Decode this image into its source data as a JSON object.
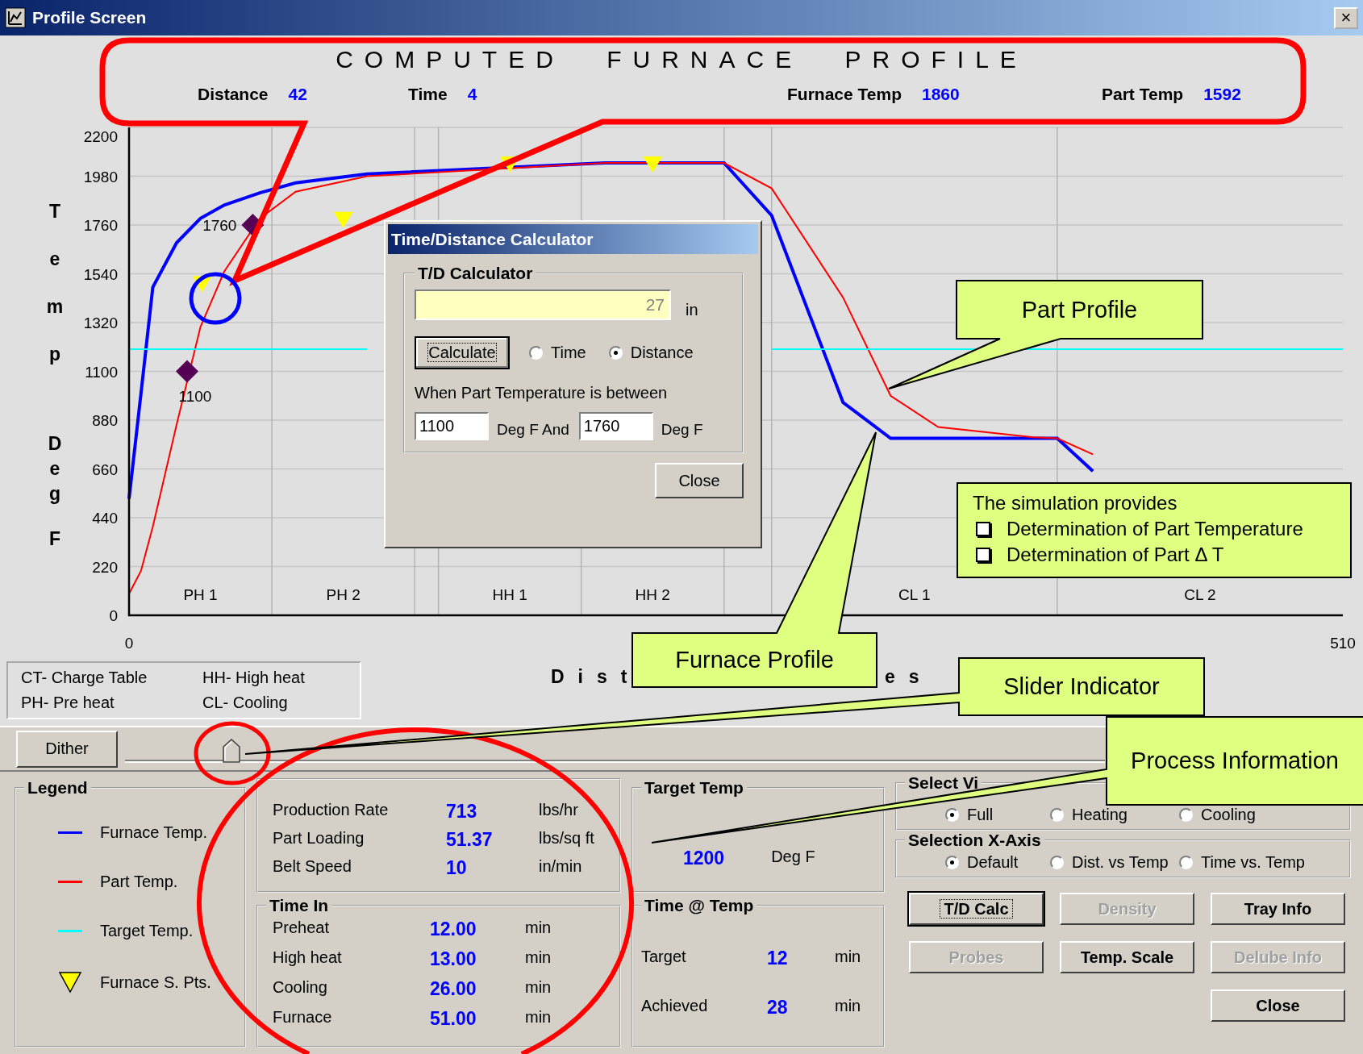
{
  "window": {
    "title": "Profile Screen",
    "close": "×"
  },
  "header": {
    "title": "COMPUTED FURNACE PROFILE",
    "stats": [
      {
        "label": "Distance",
        "value": "42"
      },
      {
        "label": "Time",
        "value": "4"
      },
      {
        "label": "Furnace Temp",
        "value": "1860"
      },
      {
        "label": "Part Temp",
        "value": "1592"
      }
    ]
  },
  "chart": {
    "y_axis_letters": [
      "T",
      "e",
      "m",
      "p",
      "D",
      "e",
      "g",
      "F"
    ],
    "x_axis_title_parts": [
      "Dist",
      "es"
    ],
    "zone_labels": [
      "PH 1",
      "PH 2",
      "HH 1",
      "HH 2",
      "CL 1",
      "CL 2"
    ],
    "point_labels": [
      "1100",
      "1760"
    ],
    "chart_data": {
      "type": "line",
      "grid": true,
      "xlim": [
        0,
        510
      ],
      "ylim": [
        0,
        2200
      ],
      "xticks": [
        0,
        510
      ],
      "yticks": [
        0,
        220,
        440,
        660,
        880,
        1100,
        1320,
        1540,
        1760,
        1980,
        2200
      ],
      "x": [
        0,
        5,
        10,
        20,
        30,
        40,
        55,
        70,
        100,
        200,
        250,
        270,
        300,
        320,
        340,
        380,
        390,
        405,
        430,
        510
      ],
      "series": [
        {
          "color": "#0000ff",
          "values": [
            526,
            1000,
            1480,
            1680,
            1790,
            1850,
            1905,
            1950,
            1990,
            2040,
            2040,
            1803,
            960,
            798,
            798,
            798,
            798,
            650,
            null,
            null
          ]
        },
        {
          "color": "#ff0000",
          "values": [
            97,
            200,
            400,
            860,
            1300,
            1550,
            1790,
            1910,
            1980,
            2040,
            2040,
            1925,
            1433,
            990,
            849,
            803,
            798,
            726,
            null,
            null
          ]
        },
        {
          "color": "#00ffff",
          "values": [
            1200,
            1200,
            1200,
            1200,
            1200,
            1200,
            1200,
            1200,
            1200,
            null,
            null,
            1200,
            1200,
            1200,
            1200,
            1200,
            1200,
            1200,
            1200,
            1200
          ]
        }
      ]
    }
  },
  "abbreviations": [
    "CT- Charge Table",
    "HH- High heat",
    "PH- Pre heat",
    "CL- Cooling"
  ],
  "dither_button": "Dither",
  "slider": {
    "level": 0.086
  },
  "legend": {
    "title": "Legend",
    "items": [
      {
        "label": "Furnace Temp.",
        "color": "#0000ff",
        "kind": "line"
      },
      {
        "label": "Part Temp.",
        "color": "#ff0000",
        "kind": "line"
      },
      {
        "label": "Target Temp.",
        "color": "#00ffff",
        "kind": "line"
      },
      {
        "label": "Furnace S. Pts.",
        "color": "#ffff00",
        "kind": "triangle"
      }
    ]
  },
  "process": [
    {
      "label": "Production Rate",
      "value": "713",
      "unit": "lbs/hr"
    },
    {
      "label": "Part Loading",
      "value": "51.37",
      "unit": "lbs/sq ft"
    },
    {
      "label": "Belt Speed",
      "value": "10",
      "unit": "in/min"
    }
  ],
  "time_in": {
    "title": "Time In",
    "rows": [
      {
        "label": "Preheat",
        "value": "12.00",
        "unit": "min"
      },
      {
        "label": "High heat",
        "value": "13.00",
        "unit": "min"
      },
      {
        "label": "Cooling",
        "value": "26.00",
        "unit": "min"
      },
      {
        "label": "Furnace",
        "value": "51.00",
        "unit": "min"
      }
    ]
  },
  "target_temp": {
    "title": "Target Temp",
    "value": "1200",
    "unit": "Deg F"
  },
  "time_at_temp": {
    "title": "Time @ Temp",
    "rows": [
      {
        "label": "Target",
        "value": "12",
        "unit": "min"
      },
      {
        "label": "Achieved",
        "value": "28",
        "unit": "min"
      }
    ]
  },
  "select_view": {
    "title": "Select Vi",
    "options": [
      {
        "label": "Full",
        "selected": true
      },
      {
        "label": "Heating",
        "selected": false
      },
      {
        "label": "Cooling",
        "selected": false
      }
    ]
  },
  "x_axis_selection": {
    "title": "Selection X-Axis",
    "options": [
      {
        "label": "Default",
        "selected": true
      },
      {
        "label": "Dist. vs Temp",
        "selected": false
      },
      {
        "label": "Time vs. Temp",
        "selected": false
      }
    ]
  },
  "buttons": [
    {
      "label": "T/D Calc",
      "disabled": false,
      "focused": true
    },
    {
      "label": "Density",
      "disabled": true,
      "focused": false
    },
    {
      "label": "Tray Info",
      "disabled": false,
      "focused": false
    },
    {
      "label": "Probes",
      "disabled": true,
      "focused": false
    },
    {
      "label": "Temp. Scale",
      "disabled": false,
      "focused": false
    },
    {
      "label": "Delube Info",
      "disabled": true,
      "focused": false
    },
    {
      "label": "Close",
      "disabled": false,
      "focused": false
    }
  ],
  "dialog": {
    "title": "Time/Distance Calculator",
    "group_title": "T/D Calculator",
    "result": "27",
    "result_unit": "in",
    "calculate": "Calculate",
    "modes": [
      {
        "label": "Time",
        "selected": false
      },
      {
        "label": "Distance",
        "selected": true
      }
    ],
    "range_prompt": "When Part Temperature is between",
    "from": "1100",
    "from_unit": "Deg F And",
    "to": "1760",
    "to_unit": "Deg F",
    "close": "Close"
  },
  "callouts": [
    {
      "text": "Part Profile"
    },
    {
      "text": "Furnace Profile"
    },
    {
      "text": "Slider Indicator"
    },
    {
      "text": "Process Information"
    }
  ],
  "note": {
    "title": "The simulation provides",
    "items": [
      "Determination of Part Temperature",
      "Determination of Part Δ T"
    ]
  }
}
